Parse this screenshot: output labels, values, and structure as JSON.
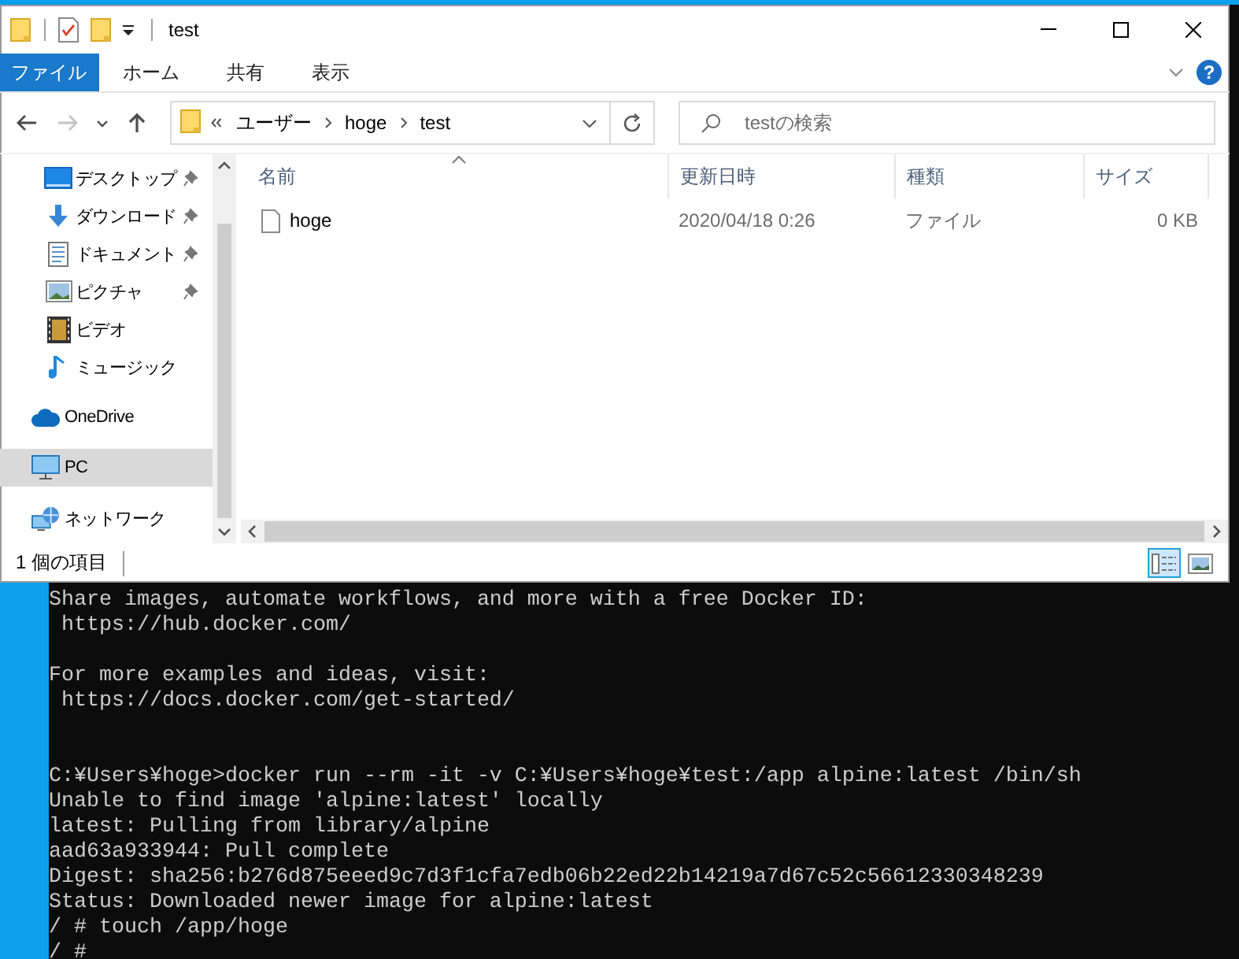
{
  "window": {
    "title": "test"
  },
  "ribbon": {
    "tabs": [
      {
        "label": "ファイル",
        "kind": "file"
      },
      {
        "label": "ホーム",
        "kind": "tab"
      },
      {
        "label": "共有",
        "kind": "tab"
      },
      {
        "label": "表示",
        "kind": "tab"
      }
    ],
    "help": "?"
  },
  "nav_buttons": [
    {
      "kind": "back",
      "disabled": false
    },
    {
      "kind": "forward",
      "disabled": true
    },
    {
      "kind": "recent",
      "disabled": false
    },
    {
      "kind": "up",
      "disabled": false
    }
  ],
  "address": {
    "path": [
      "ユーザー",
      "hoge",
      "test"
    ]
  },
  "search": {
    "placeholder": "testの検索"
  },
  "nav_pane": {
    "groups": [
      {
        "kind": "quick-access",
        "items": [
          {
            "label": "デスクトップ",
            "kind": "desktop",
            "pinned": true,
            "selected": false
          },
          {
            "label": "ダウンロード",
            "kind": "downloads",
            "pinned": true,
            "selected": false
          },
          {
            "label": "ドキュメント",
            "kind": "documents",
            "pinned": true,
            "selected": false
          },
          {
            "label": "ピクチャ",
            "kind": "pictures",
            "pinned": true,
            "selected": false
          },
          {
            "label": "ビデオ",
            "kind": "videos",
            "pinned": false,
            "selected": false
          },
          {
            "label": "ミュージック",
            "kind": "music",
            "pinned": false,
            "selected": false
          }
        ]
      },
      {
        "kind": "root",
        "items": [
          {
            "label": "OneDrive",
            "kind": "cloud",
            "pinned": false,
            "selected": false
          }
        ]
      },
      {
        "kind": "root",
        "items": [
          {
            "label": "PC",
            "kind": "pc",
            "pinned": false,
            "selected": true
          }
        ]
      },
      {
        "kind": "root",
        "items": [
          {
            "label": "ネットワーク",
            "kind": "network",
            "pinned": false,
            "selected": false
          }
        ]
      }
    ]
  },
  "file_list": {
    "columns": [
      {
        "label": "名前",
        "sorted": true
      },
      {
        "label": "更新日時",
        "sorted": false
      },
      {
        "label": "種類",
        "sorted": false
      },
      {
        "label": "サイズ",
        "sorted": false
      }
    ],
    "rows": [
      {
        "name": "hoge",
        "modified": "2020/04/18 0:26",
        "type": "ファイル",
        "size": "0 KB",
        "selected": false
      }
    ]
  },
  "status_bar": {
    "item_count": "1 個の項目",
    "view_buttons": [
      {
        "kind": "details",
        "selected": true
      },
      {
        "kind": "large-icons",
        "selected": false
      }
    ]
  },
  "terminal": {
    "blocks": [
      {
        "lines": [
          "Share images, automate workflows, and more with a free Docker ID:",
          " https://hub.docker.com/"
        ]
      },
      {
        "lines": [
          "For more examples and ideas, visit:",
          " https://docs.docker.com/get-started/"
        ]
      },
      {
        "lines": [
          "C:¥Users¥hoge>docker run --rm -it -v C:¥Users¥hoge¥test:/app alpine:latest /bin/sh",
          "Unable to find image 'alpine:latest' locally",
          "latest: Pulling from library/alpine",
          "aad63a933944: Pull complete",
          "Digest: sha256:b276d875eeed9c7d3f1cfa7edb06b22ed22b14219a7d67c52c56612330348239",
          "Status: Downloaded newer image for alpine:latest",
          "/ # touch /app/hoge",
          "/ #"
        ]
      }
    ]
  }
}
